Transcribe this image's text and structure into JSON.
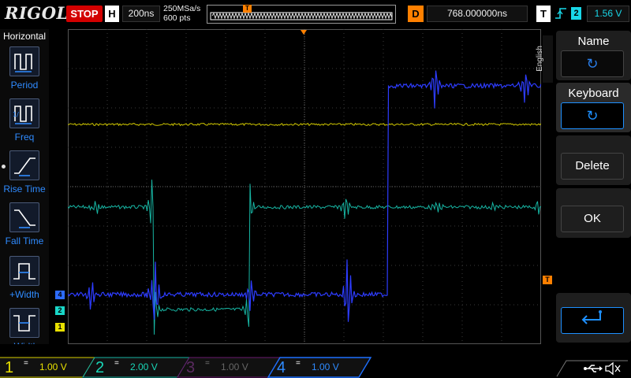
{
  "topbar": {
    "logo": "RIGOL",
    "run_state": "STOP",
    "horizontal_badge": "H",
    "timebase": "200ns",
    "sample_rate": "250MSa/s",
    "memory_depth": "600 pts",
    "trigger_pos_marker": "T",
    "delay_badge": "D",
    "delay": "768.000000ns",
    "trigger_badge": "T",
    "trigger_source": "2",
    "trigger_level": "1.56 V",
    "edge_icon": "rising-edge-icon"
  },
  "left_menu": {
    "title": "Horizontal",
    "items": [
      {
        "label": "Period",
        "icon": "period-icon"
      },
      {
        "label": "Freq",
        "icon": "freq-icon"
      },
      {
        "label": "Rise Time",
        "icon": "rise-time-icon"
      },
      {
        "label": "Fall Time",
        "icon": "fall-time-icon"
      },
      {
        "label": "+Width",
        "icon": "pos-width-icon"
      },
      {
        "label": "-Width",
        "icon": "neg-width-icon"
      }
    ]
  },
  "right_menu": {
    "language": "English",
    "buttons": [
      {
        "label": "Name",
        "icon": "rotate-knob-icon"
      },
      {
        "label": "Keyboard",
        "icon": "rotate-knob-icon"
      },
      {
        "label": "Delete"
      },
      {
        "label": "OK"
      },
      {
        "label": "",
        "icon": "enter-icon"
      }
    ]
  },
  "channels": [
    {
      "num": "1",
      "coupling": "=",
      "scale": "1.00 V",
      "color": "#e8e000"
    },
    {
      "num": "2",
      "coupling": "=",
      "scale": "2.00 V",
      "color": "#19d7b8"
    },
    {
      "num": "3",
      "coupling": "=",
      "scale": "1.00 V",
      "color": "#b020c0"
    },
    {
      "num": "4",
      "coupling": "=",
      "scale": "1.00 V",
      "color": "#1e70ff"
    }
  ],
  "markers": {
    "ch4": "4",
    "ch2": "2",
    "ch1": "1",
    "trigger": "T"
  },
  "bottom_icons": [
    "usb-icon",
    "speaker-mute-icon"
  ],
  "colors": {
    "ch1": "#d8d000",
    "ch2": "#1ab8a8",
    "ch4": "#2244ff",
    "accent": "#ff8000",
    "stop": "#d30000"
  }
}
